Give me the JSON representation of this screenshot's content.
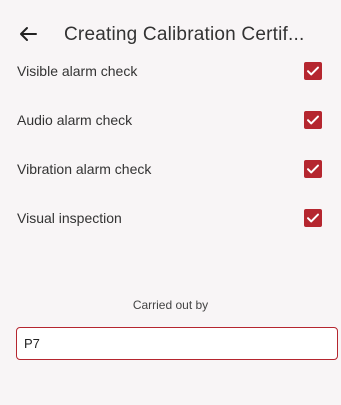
{
  "header": {
    "title": "Creating Calibration Certif...",
    "back_icon": "arrow-left-icon"
  },
  "checks": [
    {
      "label": "Visible alarm check",
      "checked": true
    },
    {
      "label": "Audio alarm check",
      "checked": true
    },
    {
      "label": "Vibration alarm check",
      "checked": true
    },
    {
      "label": "Visual inspection",
      "checked": true
    }
  ],
  "carried_out_by": {
    "label": "Carried out by",
    "value": "P7"
  },
  "colors": {
    "accent": "#b5262f",
    "background": "#f8f5f6"
  }
}
